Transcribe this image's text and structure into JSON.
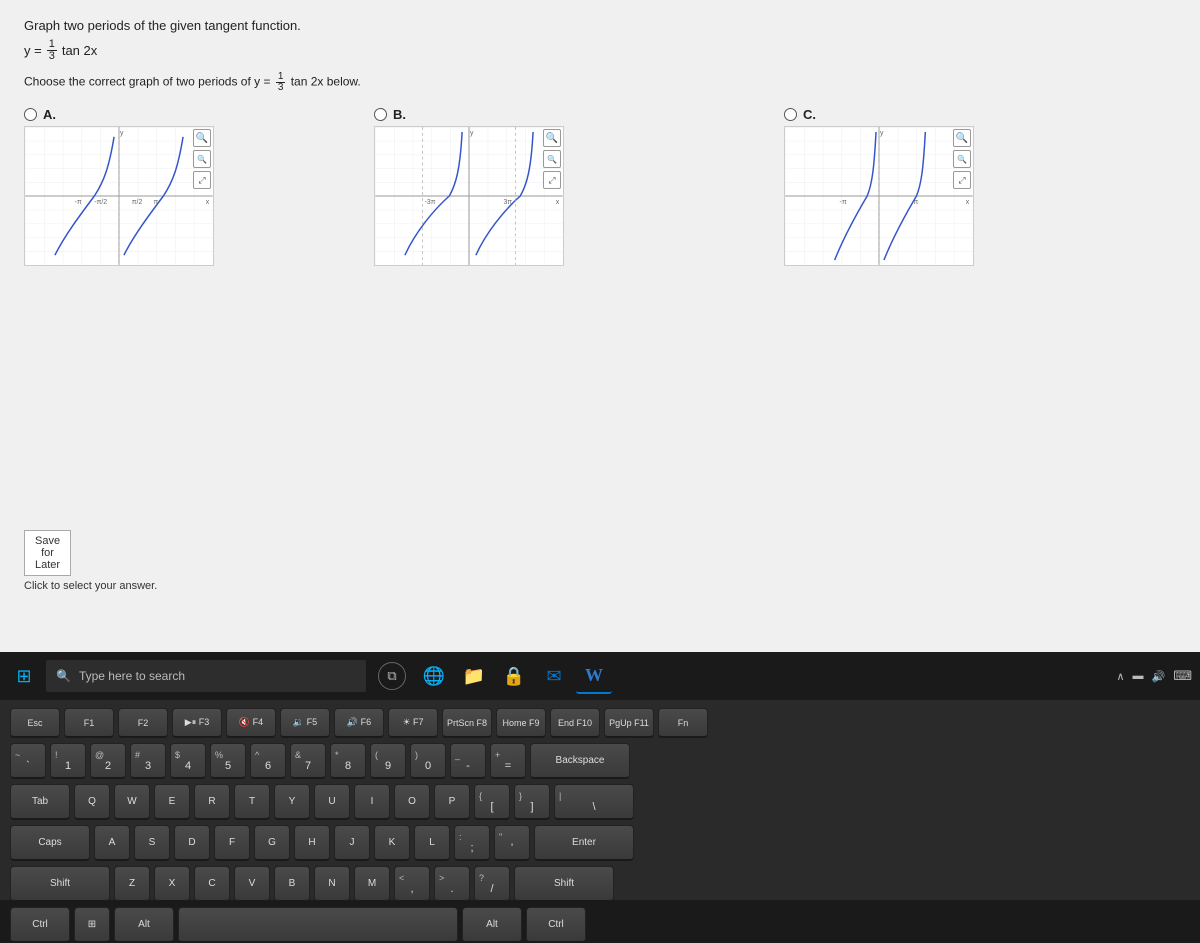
{
  "question": {
    "title": "Graph two periods of the given tangent function.",
    "equation_prefix": "y =",
    "equation_fraction_num": "1",
    "equation_fraction_den": "3",
    "equation_suffix": "tan 2x",
    "sub_question_prefix": "Choose the correct graph of two periods of y =",
    "sub_fraction_num": "1",
    "sub_fraction_den": "3",
    "sub_question_suffix": "tan 2x below."
  },
  "options": [
    {
      "letter": "A",
      "selected": false
    },
    {
      "letter": "B",
      "selected": false
    },
    {
      "letter": "C",
      "selected": false
    }
  ],
  "actions": {
    "click_to_select": "Click to select your answer.",
    "save_for_later": "Save for Later"
  },
  "taskbar": {
    "search_placeholder": "Type here to search",
    "apps": [
      "task-view",
      "edge",
      "explorer",
      "lock",
      "word"
    ],
    "right_icons": [
      "chevron-up",
      "display",
      "volume",
      "keyboard"
    ]
  },
  "keyboard": {
    "rows": [
      [
        "Esc",
        "F1",
        "F2",
        "F3",
        "F4",
        "F5",
        "F6",
        "F7",
        "F8",
        "F9",
        "F10",
        "F11",
        "PrtScn",
        "Home",
        "End",
        "PgUp",
        "Fn"
      ],
      [
        "`~",
        "1!",
        "2@",
        "3#",
        "4$",
        "5%",
        "6^",
        "7&",
        "8*",
        "9(",
        "0)",
        "-_",
        "=+",
        "Backspace"
      ],
      [
        "Tab",
        "Q",
        "W",
        "E",
        "R",
        "T",
        "Y",
        "U",
        "I",
        "O",
        "P",
        "[{",
        "]}",
        "\\|"
      ],
      [
        "Caps",
        "A",
        "S",
        "D",
        "F",
        "G",
        "H",
        "J",
        "K",
        "L",
        ";:",
        "'\"",
        "Enter"
      ],
      [
        "Shift",
        "Z",
        "X",
        "C",
        "V",
        "B",
        "N",
        "M",
        ",<",
        ".>",
        "/?",
        "Shift"
      ],
      [
        "Ctrl",
        "Win",
        "Alt",
        "Space",
        "Alt",
        "Ctrl"
      ]
    ]
  }
}
